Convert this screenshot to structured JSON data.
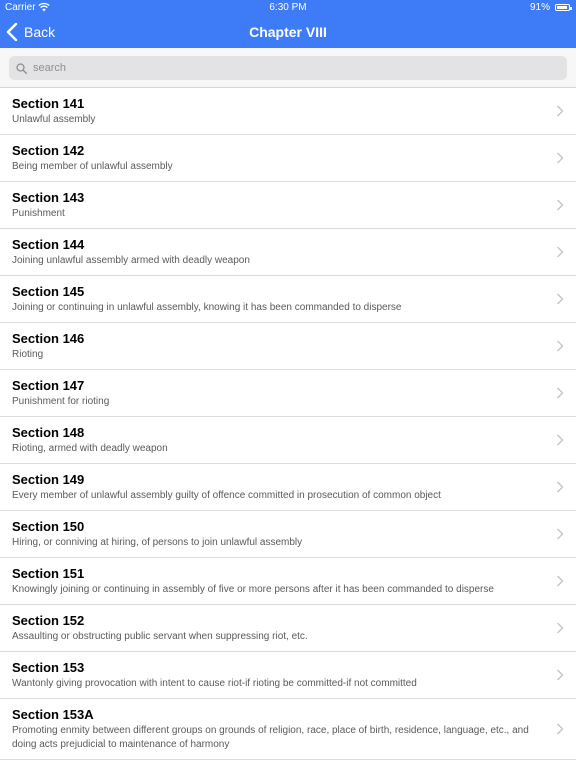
{
  "status_bar": {
    "carrier": "Carrier",
    "time": "6:30 PM",
    "battery": "91%"
  },
  "nav": {
    "back_label": "Back",
    "title": "Chapter VIII"
  },
  "search": {
    "placeholder": "search"
  },
  "sections": [
    {
      "title": "Section 141",
      "subtitle": "Unlawful assembly"
    },
    {
      "title": "Section 142",
      "subtitle": "Being member of unlawful assembly"
    },
    {
      "title": "Section 143",
      "subtitle": "Punishment"
    },
    {
      "title": "Section 144",
      "subtitle": "Joining unlawful assembly armed with deadly weapon"
    },
    {
      "title": "Section 145",
      "subtitle": "Joining or continuing in unlawful assembly, knowing it has been commanded to disperse"
    },
    {
      "title": "Section 146",
      "subtitle": "Rioting"
    },
    {
      "title": "Section 147",
      "subtitle": "Punishment for rioting"
    },
    {
      "title": "Section 148",
      "subtitle": "Rioting, armed with deadly weapon"
    },
    {
      "title": "Section 149",
      "subtitle": "Every member of unlawful assembly guilty of offence committed in prosecution of common object"
    },
    {
      "title": "Section 150",
      "subtitle": "Hiring, or conniving at hiring, of persons to join unlawful assembly"
    },
    {
      "title": "Section 151",
      "subtitle": "Knowingly joining or continuing in assembly of five or more persons after it has been commanded to disperse"
    },
    {
      "title": "Section 152",
      "subtitle": "Assaulting or obstructing public servant when suppressing riot, etc."
    },
    {
      "title": "Section 153",
      "subtitle": "Wantonly giving provocation with intent to cause riot-if rioting be committed-if not committed"
    },
    {
      "title": "Section 153A",
      "subtitle": "Promoting enmity between different groups on grounds of religion, race, place of birth, residence, language, etc., and doing acts prejudicial to maintenance of harmony"
    }
  ]
}
